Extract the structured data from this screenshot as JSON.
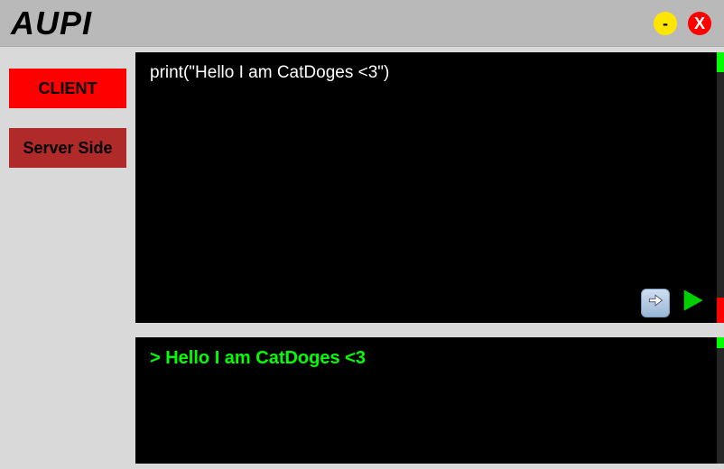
{
  "titlebar": {
    "app_name": "AUPI",
    "minimize_glyph": "-",
    "close_glyph": "X"
  },
  "sidebar": {
    "client_label": "CLIENT",
    "server_label": "Server Side"
  },
  "editor": {
    "code": "print(\"Hello I am CatDoges <3\")"
  },
  "output": {
    "line": "> Hello I am CatDoges <3"
  },
  "icons": {
    "step": "arrow-right-icon",
    "play": "play-icon"
  },
  "colors": {
    "accent_red": "#ff0000",
    "accent_red_dark": "#b02a2a",
    "accent_yellow": "#ffe600",
    "accent_green": "#00ff00",
    "panel_bg": "#000000",
    "app_bg": "#d9d9d9",
    "titlebar_bg": "#b9b9b9"
  }
}
